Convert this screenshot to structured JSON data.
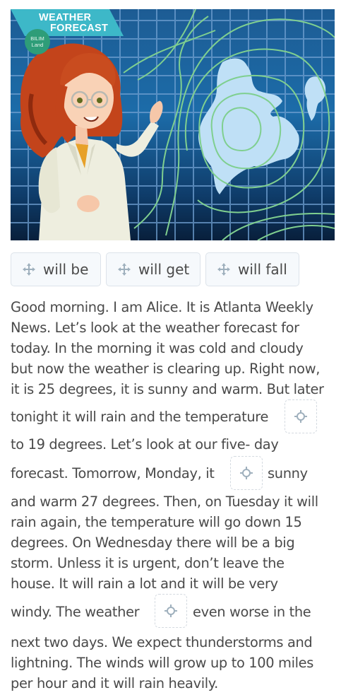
{
  "hero": {
    "banner_line1": "WEATHER",
    "banner_line2": "FORECAST",
    "logo_line1": "BILIM",
    "logo_line2": "Land",
    "image_description": "Cartoon weather presenter with red hair and glasses in front of a weather map"
  },
  "options": [
    {
      "label": "will be",
      "icon": "move-icon"
    },
    {
      "label": "will get",
      "icon": "move-icon"
    },
    {
      "label": "will fall",
      "icon": "move-icon"
    }
  ],
  "passage": {
    "lines": [
      "Good morning. I am Alice. It is Atlanta Weekly",
      "News. Let’s look at the weather forecast for",
      "today. In the morning it was cold and cloudy",
      "but now the weather is clearing up. Right now,",
      "it is 25 degrees, it is sunny and warm. But later",
      "tonight it will rain and the temperature",
      " to 19 degrees. Let’s look at our five- day",
      "forecast. Tomorrow, Monday, it",
      "sunny",
      "and warm 27 degrees. Then, on Tuesday it will",
      "rain again, the temperature will go down 15",
      "degrees. On Wednesday there will be a big",
      "storm. Unless it is urgent, don’t leave the",
      "house. It will rain a lot and it will be very",
      "windy. The weather",
      "even worse in the",
      "next two days. We expect thunderstorms and",
      "lightning. The winds will grow up to 100 miles",
      "per hour and it will rain heavily."
    ],
    "blanks": [
      {
        "value": "",
        "icon": "drop-target-icon"
      },
      {
        "value": "",
        "icon": "drop-target-icon"
      },
      {
        "value": "",
        "icon": "drop-target-icon"
      }
    ]
  },
  "colors": {
    "text": "#4a4a4a",
    "option_bg": "#f6f9fc",
    "option_border": "#dde3ea",
    "slot_border": "#d4dae0",
    "icon": "#9fb0bd"
  }
}
